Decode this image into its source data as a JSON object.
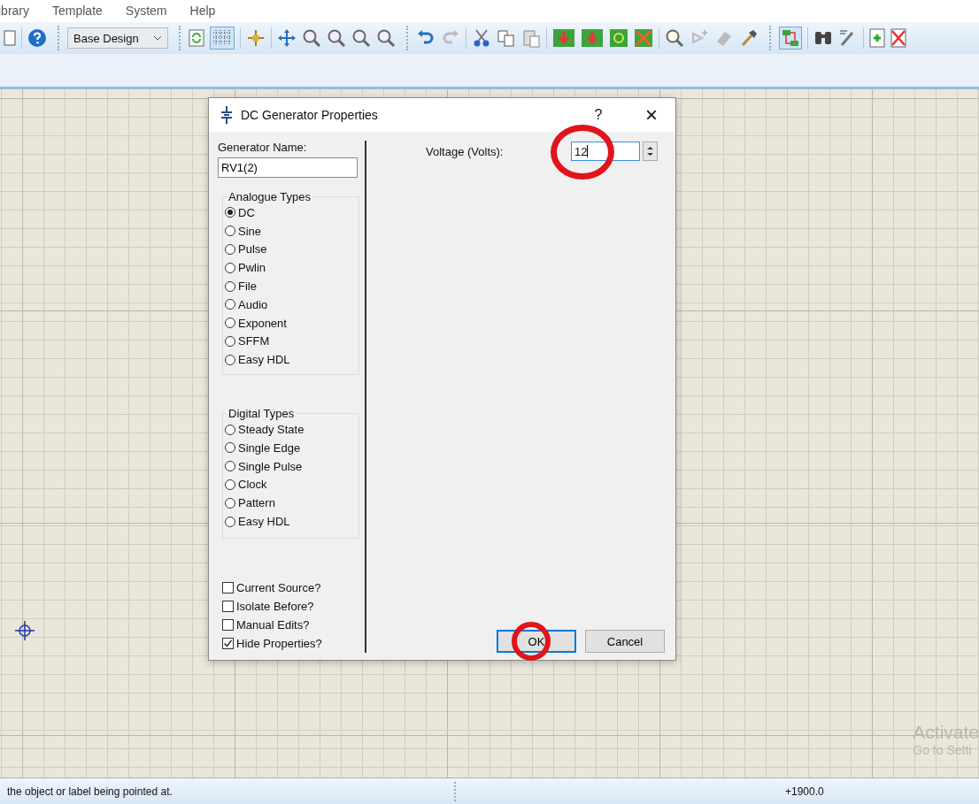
{
  "menu": [
    "ibrary",
    "Template",
    "System",
    "Help"
  ],
  "toolbar": {
    "design_combo": "Base Design"
  },
  "dialog": {
    "title": "DC Generator Properties",
    "help": "?",
    "close": "×",
    "name_label": "Generator Name:",
    "name_value": "RV1(2)",
    "analogue": {
      "title": "Analogue Types",
      "options": [
        {
          "label": "DC",
          "selected": true
        },
        {
          "label": "Sine",
          "selected": false
        },
        {
          "label": "Pulse",
          "selected": false
        },
        {
          "label": "Pwlin",
          "selected": false
        },
        {
          "label": "File",
          "selected": false
        },
        {
          "label": "Audio",
          "selected": false
        },
        {
          "label": "Exponent",
          "selected": false
        },
        {
          "label": "SFFM",
          "selected": false
        },
        {
          "label": "Easy HDL",
          "selected": false
        }
      ]
    },
    "digital": {
      "title": "Digital Types",
      "options": [
        {
          "label": "Steady State",
          "selected": false
        },
        {
          "label": "Single Edge",
          "selected": false
        },
        {
          "label": "Single Pulse",
          "selected": false
        },
        {
          "label": "Clock",
          "selected": false
        },
        {
          "label": "Pattern",
          "selected": false
        },
        {
          "label": "Easy HDL",
          "selected": false
        }
      ]
    },
    "checks": [
      {
        "label": "Current Source?",
        "checked": false
      },
      {
        "label": "Isolate Before?",
        "checked": false
      },
      {
        "label": "Manual Edits?",
        "checked": false
      },
      {
        "label": "Hide Properties?",
        "checked": true
      }
    ],
    "voltage_label": "Voltage (Volts):",
    "voltage_value": "12",
    "buttons": [
      "OK",
      "Cancel"
    ]
  },
  "os_notice": [
    "Activate",
    "Go to Setti"
  ],
  "status_bar": {
    "hint": "the object or label being pointed at.",
    "coords": "+1900.0"
  }
}
